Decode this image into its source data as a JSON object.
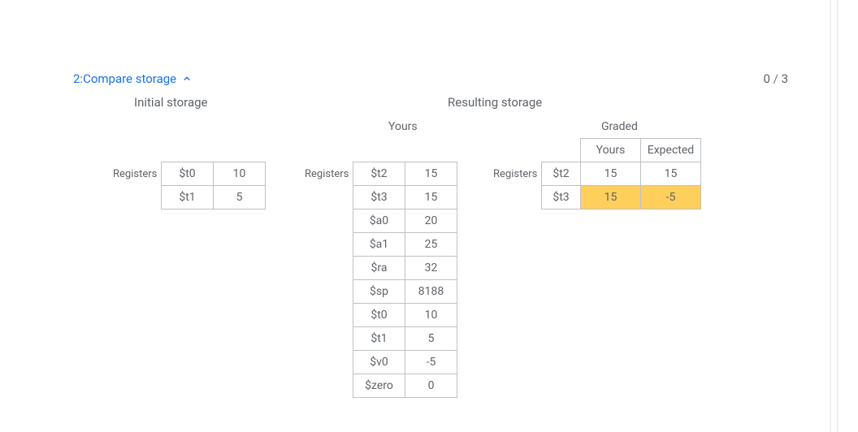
{
  "header": {
    "title": "2:Compare storage",
    "score_got": "0",
    "score_sep": " / ",
    "score_total": "3"
  },
  "sections": {
    "initial": "Initial storage",
    "resulting": "Resulting storage",
    "yours": "Yours",
    "graded": "Graded"
  },
  "labels": {
    "registers": "Registers",
    "graded_yours": "Yours",
    "graded_expected": "Expected"
  },
  "initial_registers": [
    {
      "name": "$t0",
      "value": "10"
    },
    {
      "name": "$t1",
      "value": "5"
    }
  ],
  "yours_registers": [
    {
      "name": "$t2",
      "value": "15"
    },
    {
      "name": "$t3",
      "value": "15"
    },
    {
      "name": "$a0",
      "value": "20"
    },
    {
      "name": "$a1",
      "value": "25"
    },
    {
      "name": "$ra",
      "value": "32"
    },
    {
      "name": "$sp",
      "value": "8188"
    },
    {
      "name": "$t0",
      "value": "10"
    },
    {
      "name": "$t1",
      "value": "5"
    },
    {
      "name": "$v0",
      "value": "-5"
    },
    {
      "name": "$zero",
      "value": "0"
    }
  ],
  "graded_registers": [
    {
      "name": "$t2",
      "yours": "15",
      "expected": "15",
      "mismatch": false
    },
    {
      "name": "$t3",
      "yours": "15",
      "expected": "-5",
      "mismatch": true
    }
  ],
  "colors": {
    "link": "#1a73e8",
    "border": "#bdc1c6",
    "text": "#5f6368",
    "highlight": "#ffcf5c"
  }
}
